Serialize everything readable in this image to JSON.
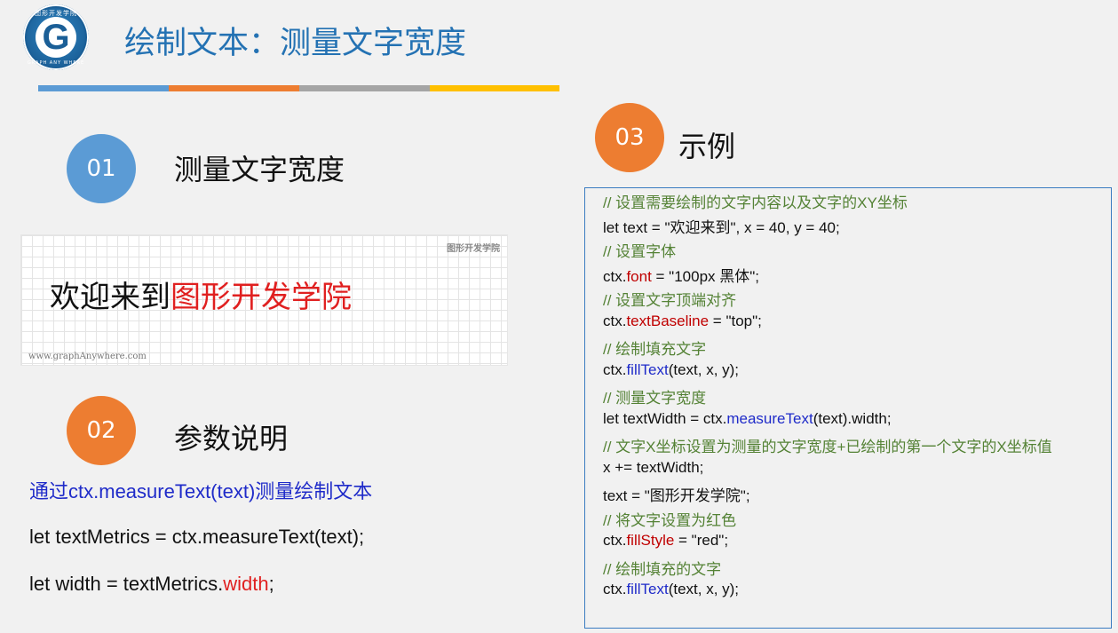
{
  "logo": {
    "letter": "G",
    "top_text": "图形开发学院",
    "bottom_text": "GRAPH ANY WHERE"
  },
  "title": "绘制文本：测量文字宽度",
  "colors": {
    "stripe": [
      "#5b9bd5",
      "#ed7d31",
      "#a5a5a5",
      "#ffc000"
    ]
  },
  "sections": [
    {
      "num": "01",
      "heading": "测量文字宽度"
    },
    {
      "num": "02",
      "heading": "参数说明"
    },
    {
      "num": "03",
      "heading": "示例"
    }
  ],
  "preview": {
    "brand": "图形开发学院",
    "black_text": "欢迎来到",
    "red_text": "图形开发学院",
    "url": "www.graphAnywhere.com"
  },
  "params": {
    "desc_a": "通过",
    "desc_b": "ctx.measureText(text)",
    "desc_c": "测量绘制文本",
    "line1": "let textMetrics = ctx.measureText(text);",
    "line2_pre": "let width = textMetrics.",
    "line2_prop": "width",
    "line2_post": ";"
  },
  "code": {
    "c1": "// 设置需要绘制的文字内容以及文字的XY坐标",
    "l2": "let text = \"欢迎来到\", x = 40, y = 40;",
    "c3": "// 设置字体",
    "l4_a": "ctx.",
    "l4_p": "font",
    "l4_b": " = \"100px 黑体\";",
    "c5": "// 设置文字顶端对齐",
    "l6_a": "ctx.",
    "l6_p": "textBaseline",
    "l6_b": " = \"top\";",
    "c7": "// 绘制填充文字",
    "l8_a": "ctx.",
    "l8_p": "fillText",
    "l8_b": "(text, x, y);",
    "c9": "// 测量文字宽度",
    "l10_a": "let textWidth = ctx.",
    "l10_p": "measureText",
    "l10_b": "(text).width;",
    "c11": "// 文字X坐标设置为测量的文字宽度+已绘制的第一个文字的X坐标值",
    "l12": "x += textWidth;",
    "l13": "text = \"图形开发学院\";",
    "c14": "// 将文字设置为红色",
    "l15_a": "ctx.",
    "l15_p": "fillStyle",
    "l15_b": " = \"red\";",
    "c16": "// 绘制填充的文字",
    "l17_a": "ctx.",
    "l17_p": "fillText",
    "l17_b": "(text, x, y);"
  }
}
